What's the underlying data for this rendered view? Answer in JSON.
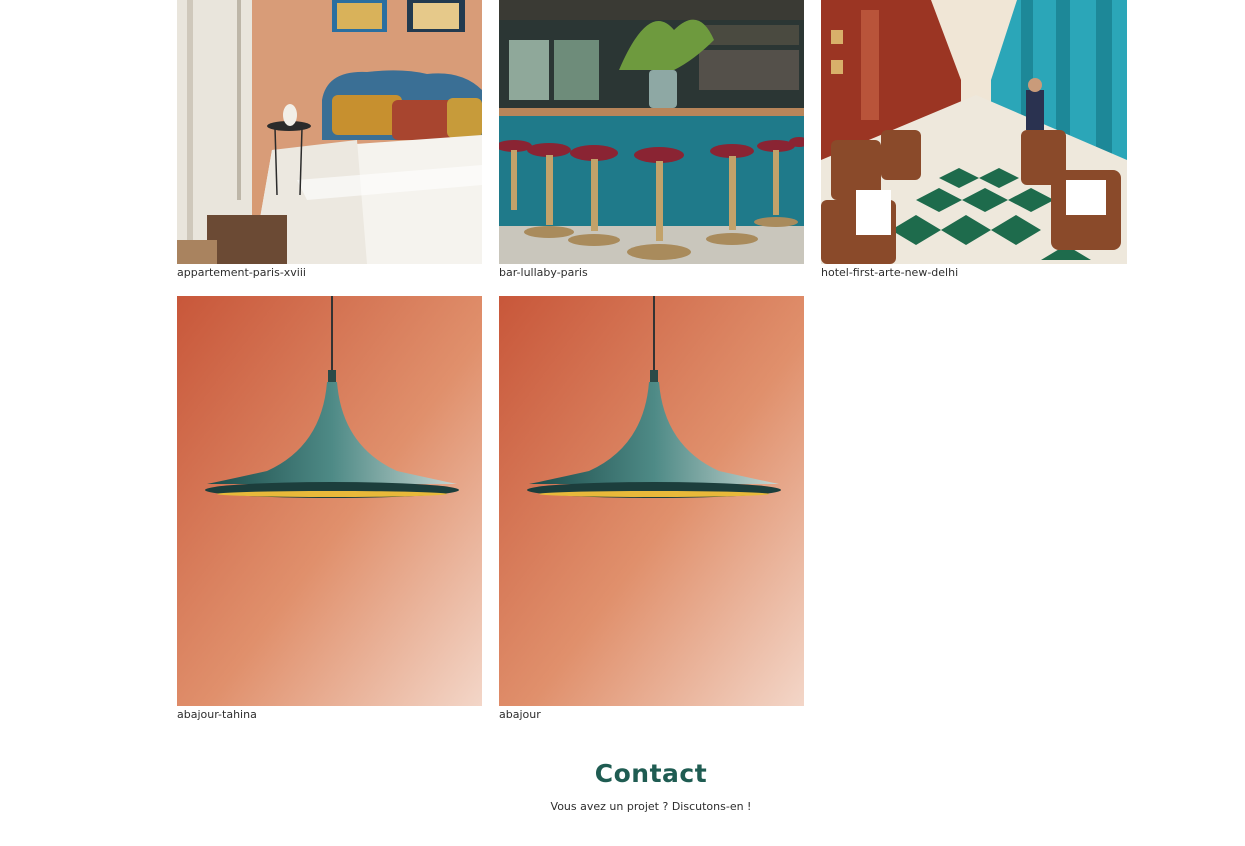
{
  "gallery": {
    "items": [
      {
        "caption": "appartement-paris-xviii",
        "image": "bedroom-photo"
      },
      {
        "caption": "bar-lullaby-paris",
        "image": "bar-photo"
      },
      {
        "caption": "hotel-first-arte-new-delhi",
        "image": "restaurant-photo"
      },
      {
        "caption": "abajour-tahina",
        "image": "pendant-lamp-photo"
      },
      {
        "caption": "abajour",
        "image": "pendant-lamp-photo"
      }
    ]
  },
  "contact": {
    "title": "Contact",
    "subtitle": "Vous avez un projet ? Discutons-en !"
  },
  "colors": {
    "accent": "#1f5c52",
    "text": "#2d2d2d"
  }
}
